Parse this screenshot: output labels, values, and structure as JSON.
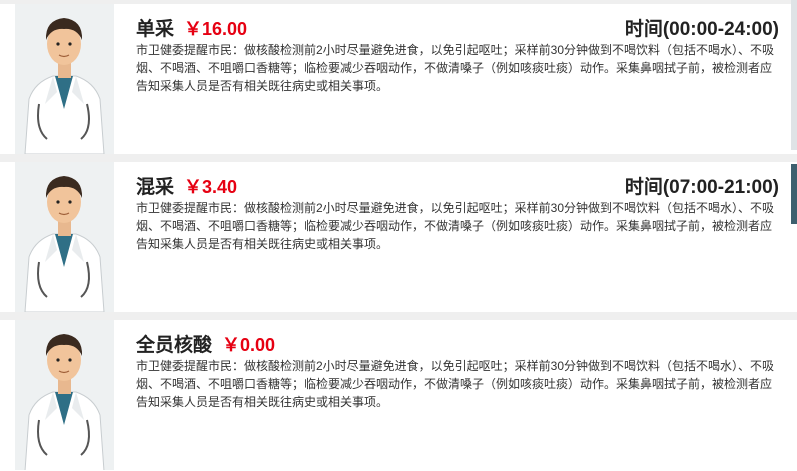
{
  "items": [
    {
      "name": "单采",
      "price": "￥16.00",
      "hours": "时间(00:00-24:00)",
      "notice": "市卫健委提醒市民：做核酸检测前2小时尽量避免进食，以免引起呕吐；采样前30分钟做到不喝饮料（包括不喝水）、不吸烟、不喝酒、不咀嚼口香糖等；临检要减少吞咽动作，不做清嗓子（例如咳痰吐痰）动作。采集鼻咽拭子前，被检测者应告知采集人员是否有相关既往病史或相关事项。"
    },
    {
      "name": "混采",
      "price": "￥3.40",
      "hours": "时间(07:00-21:00)",
      "notice": "市卫健委提醒市民：做核酸检测前2小时尽量避免进食，以免引起呕吐；采样前30分钟做到不喝饮料（包括不喝水）、不吸烟、不喝酒、不咀嚼口香糖等；临检要减少吞咽动作，不做清嗓子（例如咳痰吐痰）动作。采集鼻咽拭子前，被检测者应告知采集人员是否有相关既往病史或相关事项。"
    },
    {
      "name": "全员核酸",
      "price": "￥0.00",
      "hours": "",
      "notice": "市卫健委提醒市民：做核酸检测前2小时尽量避免进食，以免引起呕吐；采样前30分钟做到不喝饮料（包括不喝水）、不吸烟、不喝酒、不咀嚼口香糖等；临检要减少吞咽动作，不做清嗓子（例如咳痰吐痰）动作。采集鼻咽拭子前，被检测者应告知采集人员是否有相关既往病史或相关事项。"
    }
  ],
  "colors": {
    "price": "#e60012",
    "text": "#222222",
    "background": "#efefef"
  },
  "icons": [
    "doctor-avatar-icon",
    "stethoscope-icon"
  ]
}
